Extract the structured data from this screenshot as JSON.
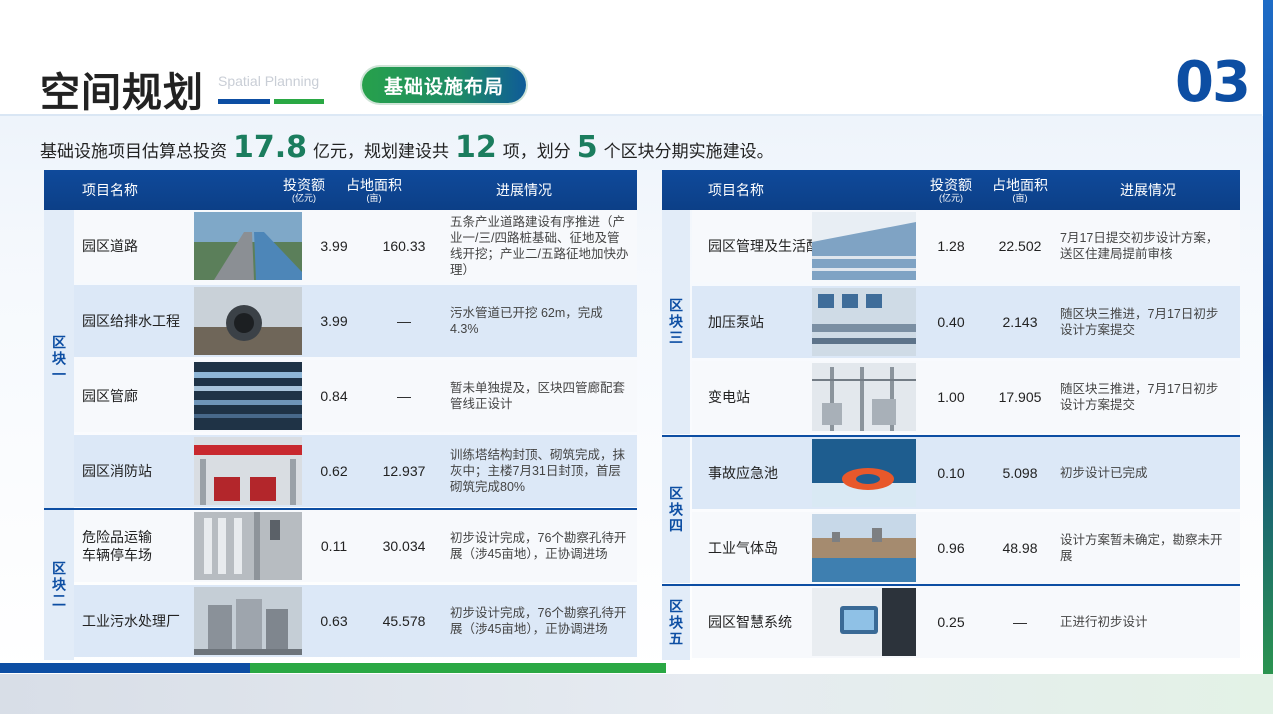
{
  "header": {
    "title": "空间规划",
    "subtitle_en": "Spatial Planning",
    "tag": "基础设施布局",
    "page_number": "03"
  },
  "summary": {
    "part1": "基础设施项目估算总投资",
    "investment": "17.8",
    "part2": "亿元，规划建设共",
    "project_count": "12",
    "part3": "项，划分",
    "block_count": "5",
    "part4": "个区块分期实施建设。"
  },
  "columns": {
    "name": "项目名称",
    "investment": "投资额",
    "investment_unit": "(亿元)",
    "area": "占地面积",
    "area_unit": "(亩)",
    "progress": "进展情况"
  },
  "left_table": {
    "zones": [
      {
        "label": "区块一"
      },
      {
        "label": "区块二"
      }
    ],
    "rows": [
      {
        "name": "园区道路",
        "investment": "3.99",
        "area": "160.33",
        "progress": "五条产业道路建设有序推进（产业一/三/四路桩基础、征地及管线开挖；产业二/五路征地加快办理）",
        "image": "road-image"
      },
      {
        "name": "园区给排水工程",
        "investment": "3.99",
        "area": "—",
        "progress": "污水管道已开挖 62m，完成 4.3%",
        "image": "pipe-image"
      },
      {
        "name": "园区管廊",
        "investment": "0.84",
        "area": "—",
        "progress": "暂未单独提及，区块四管廊配套管线正设计",
        "image": "tunnel-image"
      },
      {
        "name": "园区消防站",
        "investment": "0.62",
        "area": "12.937",
        "progress": "训练塔结构封顶、砌筑完成，抹灰中；主楼7月31日封顶，首层砌筑完成80%",
        "image": "fire-station-image"
      },
      {
        "name": "危险品运输车辆停车场",
        "investment": "0.11",
        "area": "30.034",
        "progress": "初步设计完成，76个勘察孔待开展（涉45亩地），正协调进场",
        "image": "parking-image"
      },
      {
        "name": "工业污水处理厂",
        "investment": "0.63",
        "area": "45.578",
        "progress": "初步设计完成，76个勘察孔待开展（涉45亩地），正协调进场",
        "image": "tanks-image"
      }
    ]
  },
  "right_table": {
    "zones": [
      {
        "label": "区块三"
      },
      {
        "label": "区块四"
      },
      {
        "label": "区块五"
      }
    ],
    "rows": [
      {
        "name": "园区管理及生活配套中心",
        "investment": "1.28",
        "area": "22.502",
        "progress": "7月17日提交初步设计方案，送区住建局提前审核",
        "image": "building-image"
      },
      {
        "name": "加压泵站",
        "investment": "0.40",
        "area": "2.143",
        "progress": "随区块三推进，7月17日初步设计方案提交",
        "image": "pump-image"
      },
      {
        "name": "变电站",
        "investment": "1.00",
        "area": "17.905",
        "progress": "随区块三推进，7月17日初步设计方案提交",
        "image": "substation-image"
      },
      {
        "name": "事故应急池",
        "investment": "0.10",
        "area": "5.098",
        "progress": "初步设计已完成",
        "image": "lifebuoy-image"
      },
      {
        "name": "工业气体岛",
        "investment": "0.96",
        "area": "48.98",
        "progress": "设计方案暂未确定，勘察未开展",
        "image": "industrial-image"
      },
      {
        "name": "园区智慧系统",
        "investment": "0.25",
        "area": "—",
        "progress": "正进行初步设计",
        "image": "tablet-image"
      }
    ]
  }
}
